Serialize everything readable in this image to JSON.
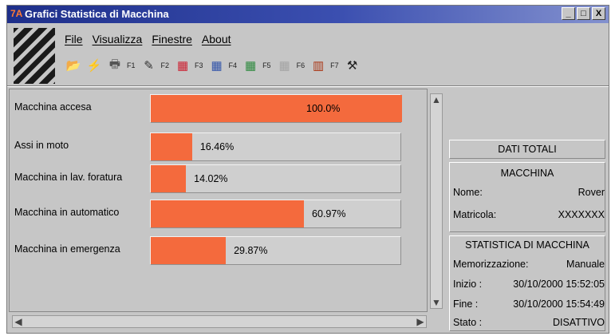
{
  "window": {
    "title": "Grafici Statistica di Macchina",
    "app_icon": "7A",
    "buttons": [
      "_",
      "□",
      "X"
    ]
  },
  "menu": [
    "File",
    "Visualizza",
    "Finestre",
    "About"
  ],
  "toolbar": {
    "icons": [
      "open-folder-icon",
      "lightning-icon",
      "printer-icon"
    ],
    "fkeys": [
      "F1",
      "F2",
      "F3",
      "F4",
      "F5",
      "F6",
      "F7"
    ],
    "fkey_icons": [
      "edit-icon",
      "red-doc-icon",
      "blue-doc-icon",
      "green-doc-icon",
      "dim-doc-icon",
      "bar-chart-icon",
      "tools-icon"
    ]
  },
  "chart_data": {
    "type": "bar",
    "orientation": "horizontal",
    "categories": [
      "Macchina accesa",
      "Assi in moto",
      "Macchina in lav. foratura",
      "Macchina in automatico",
      "Macchina in emergenza"
    ],
    "values": [
      100.0,
      16.46,
      14.02,
      60.97,
      29.87
    ],
    "value_labels": [
      "100.0%",
      "16.46%",
      "14.02%",
      "60.97%",
      "29.87%"
    ],
    "xlim": [
      0,
      100
    ],
    "color": "#f46a3d"
  },
  "side": {
    "header": "DATI TOTALI",
    "macchina_title": "MACCHINA",
    "nome_label": "Nome:",
    "nome_value": "Rover",
    "matricola_label": "Matricola:",
    "matricola_value": "XXXXXXX",
    "statistica_title": "STATISTICA DI MACCHINA",
    "memorizzazione_label": "Memorizzazione:",
    "memorizzazione_value": "Manuale",
    "inizio_label": "Inizio :",
    "inizio_value": "30/10/2000 15:52:05",
    "fine_label": "Fine  :",
    "fine_value": "30/10/2000 15:54:49",
    "stato_label": "Stato :",
    "stato_value": "DISATTIVO"
  }
}
